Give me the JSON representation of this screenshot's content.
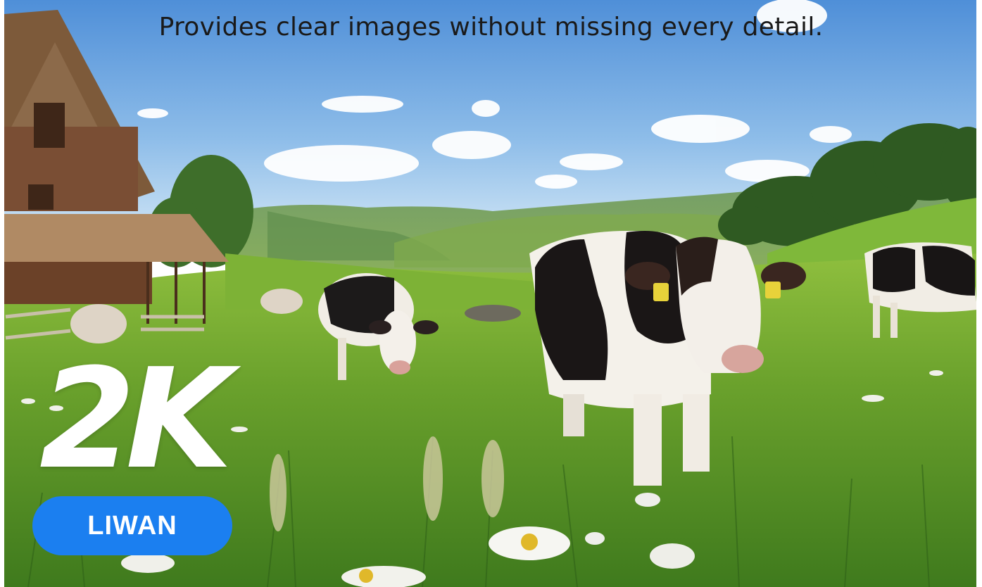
{
  "header": {
    "tagline": "Provides clear images without missing every detail."
  },
  "badge": {
    "resolution": "2K"
  },
  "brand": {
    "name": "LIWAN",
    "color": "#1b7ff0"
  },
  "scene_icons": [
    "barn-icon",
    "cow-icon",
    "cloud-icon",
    "flower-icon"
  ]
}
